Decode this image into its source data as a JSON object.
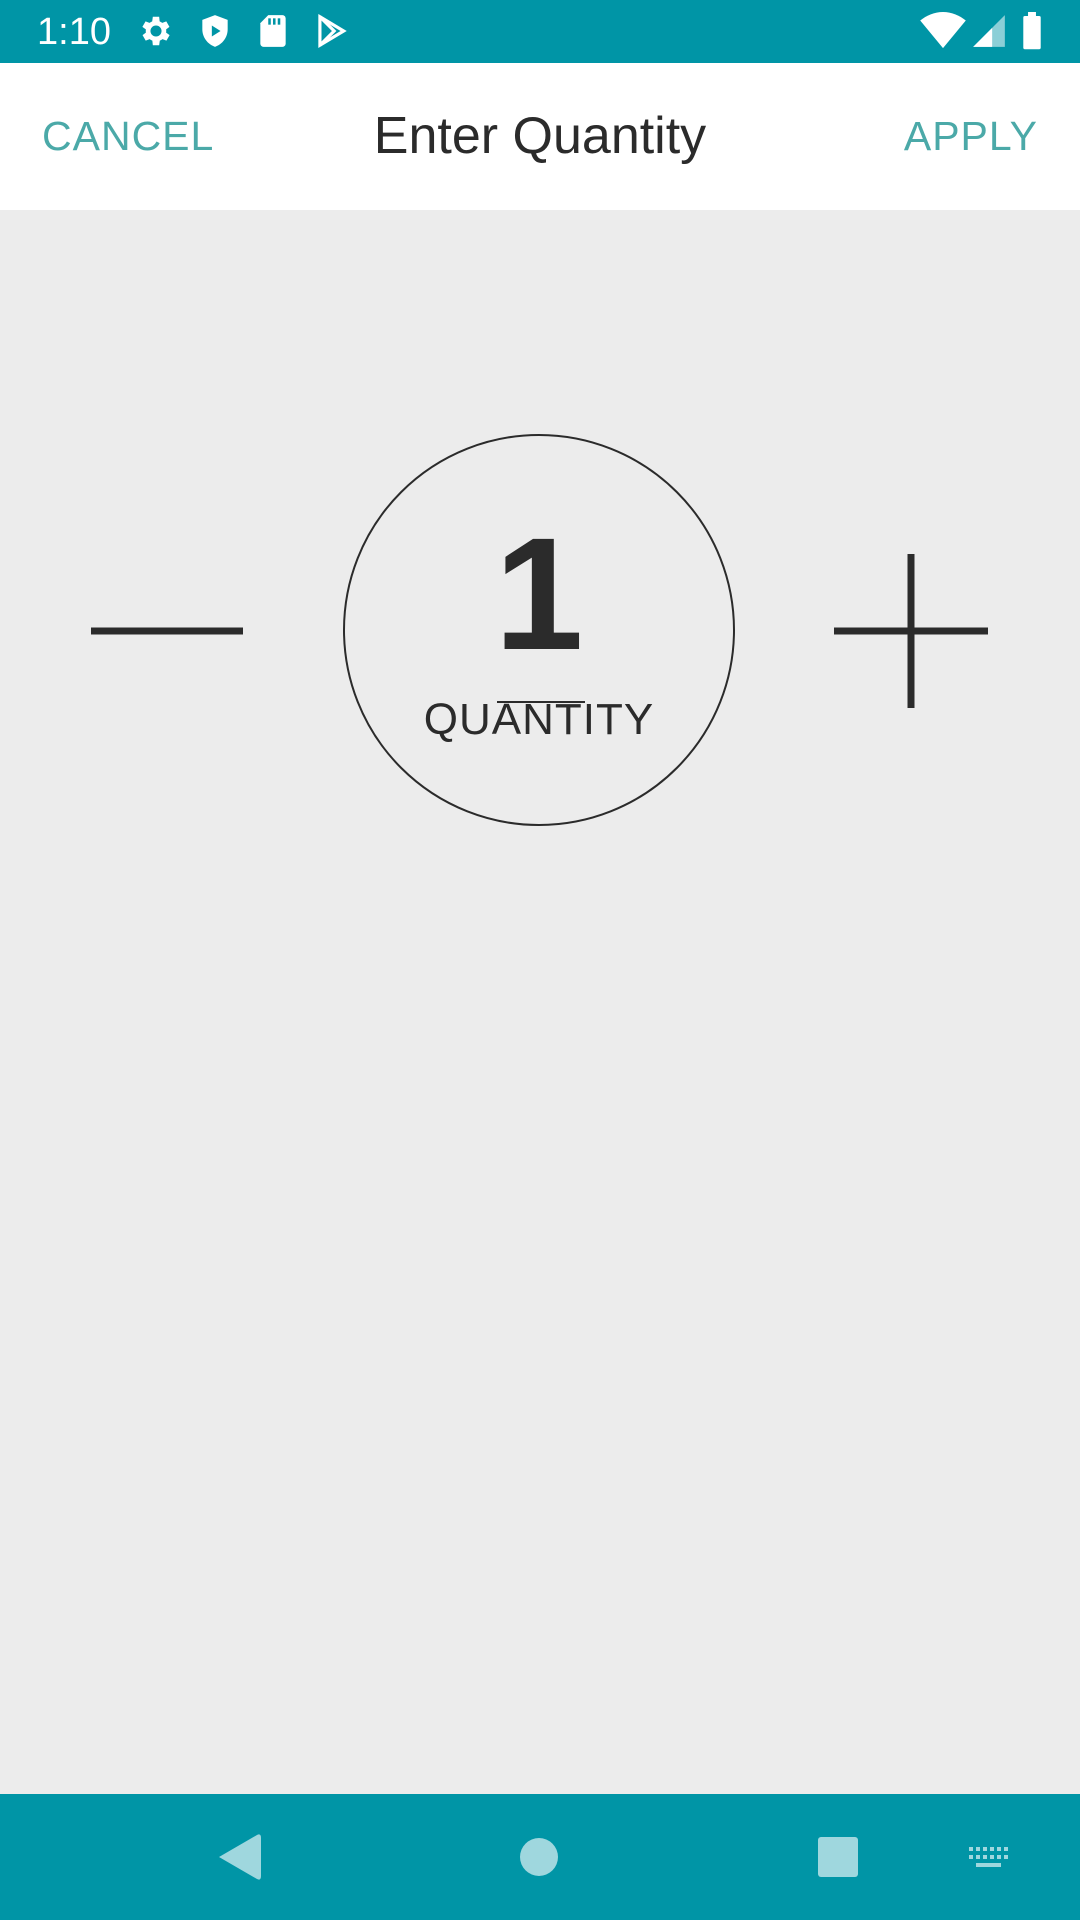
{
  "status_bar": {
    "time": "1:10",
    "left_icons": [
      "gear-icon",
      "shield-play-icon",
      "sd-card-icon",
      "play-store-icon"
    ],
    "right_icons": [
      "wifi-icon",
      "cell-signal-icon",
      "battery-icon"
    ],
    "color": "#0095a6"
  },
  "app_bar": {
    "cancel_label": "CANCEL",
    "title": "Enter Quantity",
    "apply_label": "APPLY",
    "accent_color": "#4ba9a8"
  },
  "stepper": {
    "decrement_icon": "minus-icon",
    "increment_icon": "plus-icon",
    "value": "1",
    "label": "QUANTITY"
  },
  "nav_bar": {
    "buttons": [
      "back-icon",
      "home-icon",
      "recents-icon",
      "keyboard-icon"
    ],
    "color": "#0095a6"
  },
  "colors": {
    "background": "#ececec",
    "text": "#2b2b2b"
  }
}
